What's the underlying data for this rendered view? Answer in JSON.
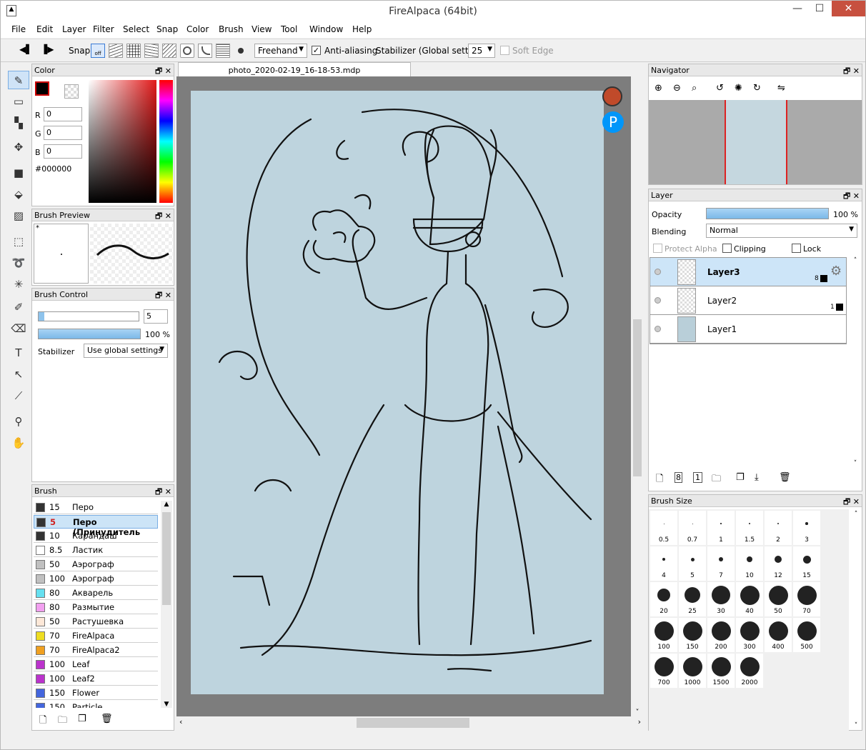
{
  "app": {
    "title": "FireAlpaca (64bit)"
  },
  "menu": [
    "File",
    "Edit",
    "Layer",
    "Filter",
    "Select",
    "Snap",
    "Color",
    "Brush",
    "View",
    "Tool",
    "Window",
    "Help"
  ],
  "toolbar": {
    "snap_label": "Snap",
    "snap_off": "off",
    "mode": "Freehand",
    "antialias_label": "Anti-aliasing",
    "antialias_checked": true,
    "stabilizer_label": "Stabilizer (Global settings)",
    "stabilizer_value": "25",
    "softedge_label": "Soft Edge"
  },
  "document_tab": "photo_2020-02-19_16-18-53.mdp",
  "color_panel": {
    "title": "Color",
    "r": "0",
    "g": "0",
    "b": "0",
    "r_label": "R",
    "g_label": "G",
    "b_label": "B",
    "hex": "#000000",
    "primary": "#000000"
  },
  "brush_preview": {
    "title": "Brush Preview",
    "marker": "*"
  },
  "brush_control": {
    "title": "Brush Control",
    "size": "5",
    "size_fraction": 0.06,
    "opacity": "100 %",
    "opacity_fraction": 1.0,
    "stabilizer_label": "Stabilizer",
    "stabilizer_value": "Use global settings"
  },
  "brush_panel": {
    "title": "Brush",
    "items": [
      {
        "size": "15",
        "name": "Перо",
        "color": "#333333"
      },
      {
        "size": "5",
        "name": "Перо (Принудитель",
        "color": "#333333",
        "selected": true
      },
      {
        "size": "10",
        "name": "Карандаш",
        "color": "#333333"
      },
      {
        "size": "8.5",
        "name": "Ластик",
        "color": "#ffffff"
      },
      {
        "size": "50",
        "name": "Аэрограф",
        "color": "#c0c0c0"
      },
      {
        "size": "100",
        "name": "Аэрограф",
        "color": "#c0c0c0"
      },
      {
        "size": "80",
        "name": "Акварель",
        "color": "#66e0f0"
      },
      {
        "size": "80",
        "name": "Размытие",
        "color": "#f2a0f0"
      },
      {
        "size": "50",
        "name": "Растушевка",
        "color": "#fde8d8"
      },
      {
        "size": "70",
        "name": "FireAlpaca",
        "color": "#eedd22"
      },
      {
        "size": "70",
        "name": "FireAlpaca2",
        "color": "#f0a020"
      },
      {
        "size": "100",
        "name": "Leaf",
        "color": "#bb33cc"
      },
      {
        "size": "100",
        "name": "Leaf2",
        "color": "#bb33cc"
      },
      {
        "size": "150",
        "name": "Flower",
        "color": "#4466dd"
      },
      {
        "size": "150",
        "name": "Particle",
        "color": "#4466dd"
      }
    ]
  },
  "navigator": {
    "title": "Navigator"
  },
  "layer_panel": {
    "title": "Layer",
    "opacity_label": "Opacity",
    "opacity_value": "100 %",
    "blending_label": "Blending",
    "blending_value": "Normal",
    "protect_alpha": "Protect Alpha",
    "clipping": "Clipping",
    "lock": "Lock",
    "layers": [
      {
        "name": "Layer3",
        "badge": "8",
        "selected": true
      },
      {
        "name": "Layer2",
        "badge": "1",
        "selected": false
      },
      {
        "name": "Layer1",
        "badge": "",
        "selected": false
      }
    ]
  },
  "brush_size_panel": {
    "title": "Brush Size",
    "sizes": [
      "0.5",
      "0.7",
      "1",
      "1.5",
      "2",
      "3",
      "4",
      "5",
      "7",
      "10",
      "12",
      "15",
      "20",
      "25",
      "30",
      "40",
      "50",
      "70",
      "100",
      "150",
      "200",
      "300",
      "400",
      "500",
      "700",
      "1000",
      "1500",
      "2000"
    ]
  }
}
